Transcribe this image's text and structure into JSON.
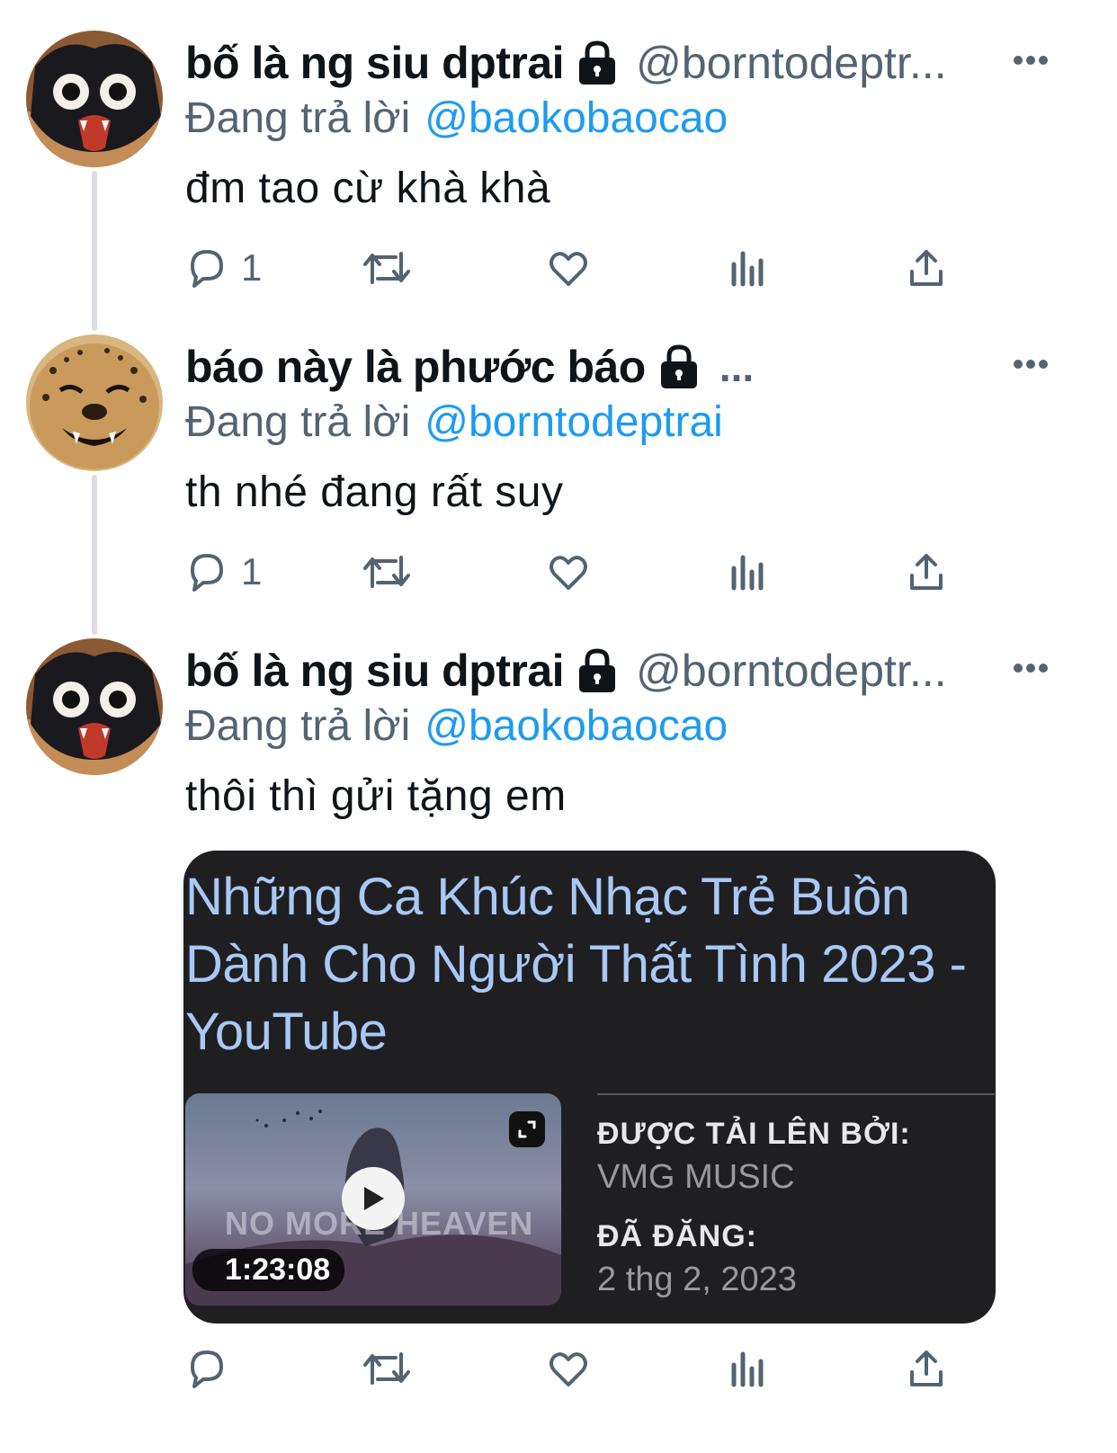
{
  "tweets": [
    {
      "display_name": "bố là ng siu dptrai",
      "handle": "@borntodeptr...",
      "replying_label": "Đang trả lời",
      "replying_to": "@baokobaocao",
      "text": "đm tao cừ khà khà",
      "reply_count": "1",
      "avatar": "cat-avatar"
    },
    {
      "display_name": "báo này là phước báo",
      "handle_truncated": "...",
      "replying_label": "Đang trả lời",
      "replying_to": "@borntodeptrai",
      "text": "th nhé đang rất suy",
      "reply_count": "1",
      "avatar": "cheetah-avatar"
    },
    {
      "display_name": "bố là ng siu dptrai",
      "handle": "@borntodeptr...",
      "replying_label": "Đang trả lời",
      "replying_to": "@baokobaocao",
      "text": "thôi thì gửi tặng em",
      "reply_count": "",
      "avatar": "cat-avatar",
      "card": {
        "title": "Những Ca Khúc Nhạc Trẻ Buồn Dành Cho Người Thất Tình 2023 - YouTube",
        "thumbnail_caption": "NO MORE HEAVEN",
        "duration": "1:23:08",
        "uploaded_by_label": "ĐƯỢC TẢI LÊN BỞI:",
        "uploaded_by": "VMG MUSIC",
        "posted_label": "ĐÃ ĐĂNG:",
        "posted_date": "2 thg 2, 2023"
      }
    }
  ],
  "colors": {
    "link": "#1d9bf0",
    "secondary_text": "#536471",
    "card_bg": "#1f1f21",
    "card_title": "#a9c8f5",
    "thread_line": "#dcdde0"
  },
  "icons": [
    "lock-icon",
    "more-icon",
    "reply-icon",
    "retweet-icon",
    "like-icon",
    "views-icon",
    "share-icon",
    "play-icon",
    "expand-icon"
  ]
}
